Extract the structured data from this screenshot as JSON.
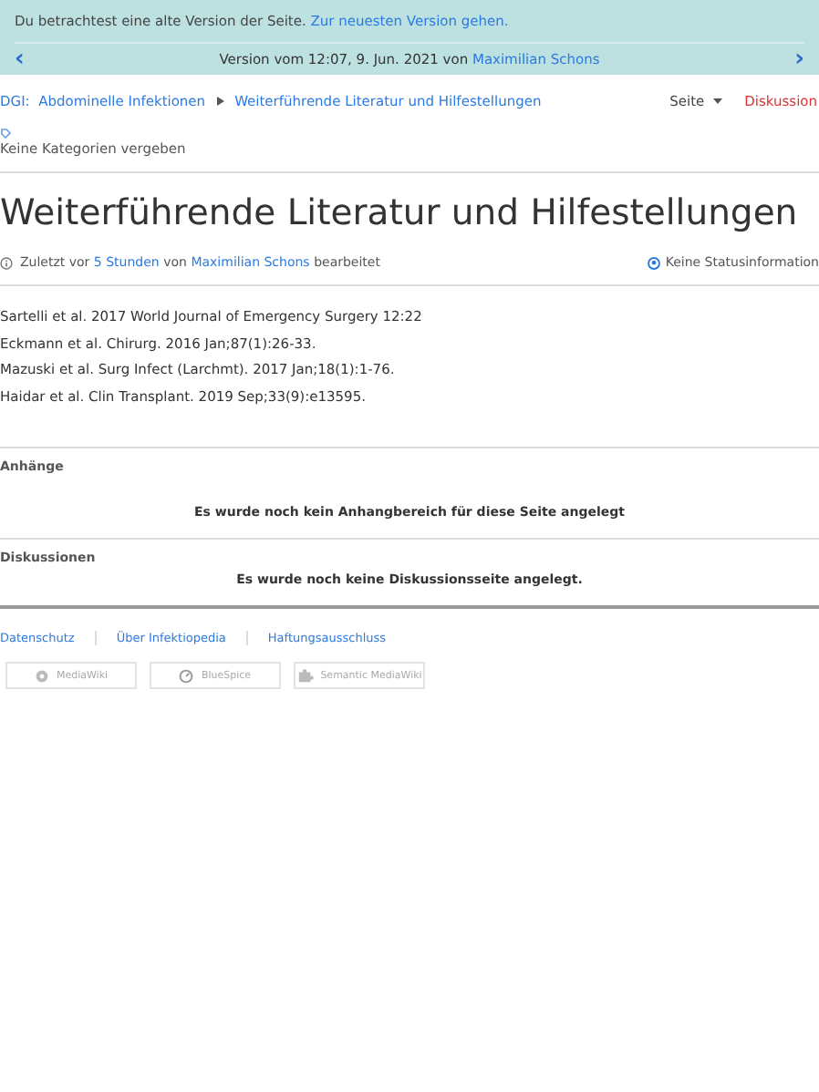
{
  "notice": {
    "text": "Du betrachtest eine alte Version der Seite.",
    "link": "Zur neuesten Version gehen."
  },
  "version_nav": {
    "prev": "‹",
    "label": "Version vom 12:07, 9. Jun. 2021 von",
    "author": "Maximilian Schons",
    "next": "›"
  },
  "breadcrumb": [
    {
      "label": "DGI:  Abdominelle Infektionen"
    },
    {
      "label": "Weiterführende Literatur und Hilfestellungen"
    }
  ],
  "page_tabs": [
    {
      "label": "Seite",
      "kind": "dropdown"
    },
    {
      "label": "Diskussion",
      "kind": "missing"
    }
  ],
  "categories": "Keine Kategorien vergeben",
  "title": "Weiterführende Literatur und Hilfestellungen",
  "meta": {
    "prefix": "Zuletzt vor",
    "time": "5 Stunden",
    "by": "von",
    "author": "Maximilian Schons",
    "suffix": "bearbeitet",
    "status": "Keine Statusinformation"
  },
  "references": [
    "Sartelli et al. 2017 World Journal of Emergency Surgery 12:22",
    "Eckmann et al. Chirurg. 2016 Jan;87(1):26-33.",
    "Mazuski et al. Surg Infect (Larchmt). 2017 Jan;18(1):1-76.",
    "Haidar et al. Clin Transplant. 2019 Sep;33(9):e13595."
  ],
  "sections": [
    {
      "heading": "Anhänge",
      "message": "Es wurde noch kein Anhangbereich für diese Seite angelegt"
    },
    {
      "heading": "Diskussionen",
      "message": "Es wurde noch keine Diskussionsseite angelegt."
    }
  ],
  "footer_links": [
    "Datenschutz",
    "Über Infektiopedia",
    "Haftungsausschluss"
  ],
  "badges": [
    {
      "label": "MediaWiki",
      "kind": "gear"
    },
    {
      "label": "BlueSpice",
      "kind": "gauge"
    },
    {
      "label": "Semantic MediaWiki",
      "kind": "puzzle"
    }
  ]
}
